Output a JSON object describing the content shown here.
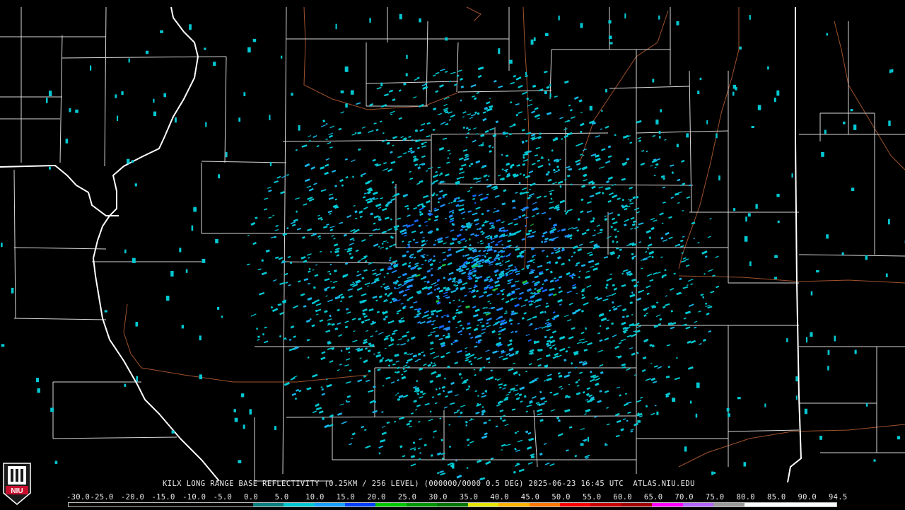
{
  "product": {
    "station": "KILX",
    "caption": "KILX LONG RANGE BASE REFLECTIVITY (0.25KM / 256 LEVEL) (000000/0000 0.5 DEG) 2025-06-23 16:45 UTC  ATLAS.NIU.EDU"
  },
  "logo": {
    "text": "NIU",
    "color": "#c8102e"
  },
  "scale": {
    "labels": [
      "-30.0",
      "-25.0",
      "-20.0",
      "-15.0",
      "-10.0",
      "-5.0",
      "0.0",
      "5.0",
      "10.0",
      "15.0",
      "20.0",
      "25.0",
      "30.0",
      "35.0",
      "40.0",
      "45.0",
      "50.0",
      "55.0",
      "60.0",
      "65.0",
      "70.0",
      "75.0",
      "80.0",
      "85.0",
      "90.0",
      "94.5"
    ],
    "colors": [
      "#000000",
      "#000000",
      "#000000",
      "#000000",
      "#000000",
      "#000000",
      "#0c8080",
      "#00c8d2",
      "#18a0ff",
      "#0040ff",
      "#00c800",
      "#009600",
      "#007800",
      "#e6e600",
      "#ffb400",
      "#ff7800",
      "#ff0000",
      "#c80000",
      "#a00000",
      "#ff00ff",
      "#b464ff",
      "#9b9b9b",
      "#ffffff",
      "#ffffff",
      "#ffffff"
    ]
  },
  "map_style": {
    "state_border_color": "#ffffff",
    "county_line_color": "#d8d8d8",
    "road_color": "#a0522d",
    "echo_colors": [
      "#00c8d2",
      "#18b4e6",
      "#1e8cff",
      "#1464ff",
      "#20c040"
    ]
  }
}
